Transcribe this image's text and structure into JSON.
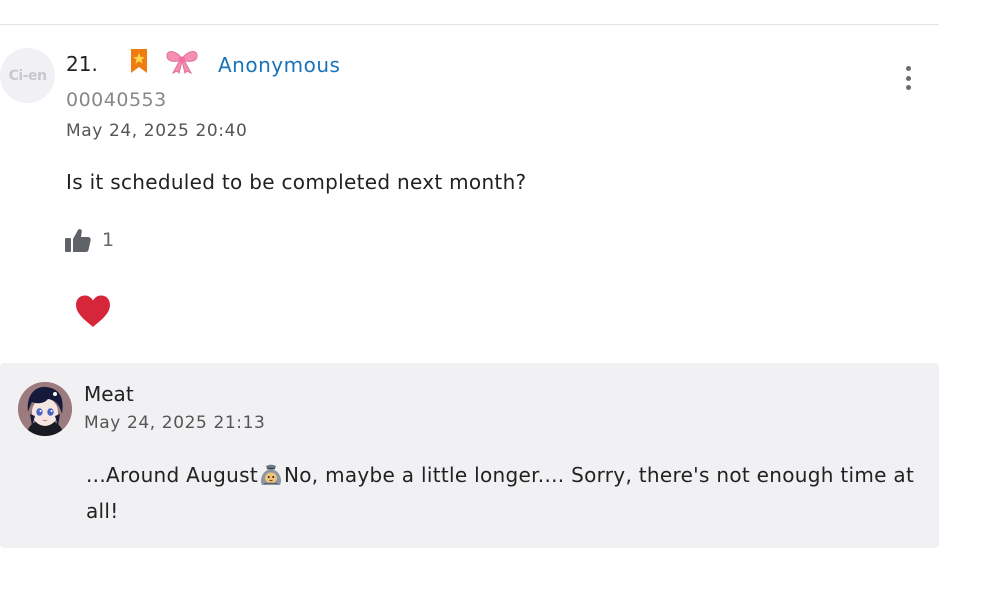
{
  "comment": {
    "avatar_text": "Ci-en",
    "number": "21.",
    "icons": [
      "bookmark-star-icon",
      "pink-bow-icon"
    ],
    "author": "Anonymous",
    "user_id": "00040553",
    "timestamp": "May 24, 2025 20:40",
    "body": "Is it scheduled to be completed next month?",
    "like_count": "1",
    "reaction_icon": "heart-icon",
    "colors": {
      "author_link": "#1a73b8",
      "heart": "#d6263a",
      "bookmark": "#f07d12",
      "bow": "#f48fb1"
    }
  },
  "reply": {
    "author": "Meat",
    "timestamp": "May 24, 2025 21:13",
    "body_before_emoji": "...Around August",
    "emoji_icon": "money-bag-creature-icon",
    "body_after_emoji": "No, maybe a little longer.... Sorry, there's not enough time at all!",
    "background": "#f1f0f2"
  }
}
